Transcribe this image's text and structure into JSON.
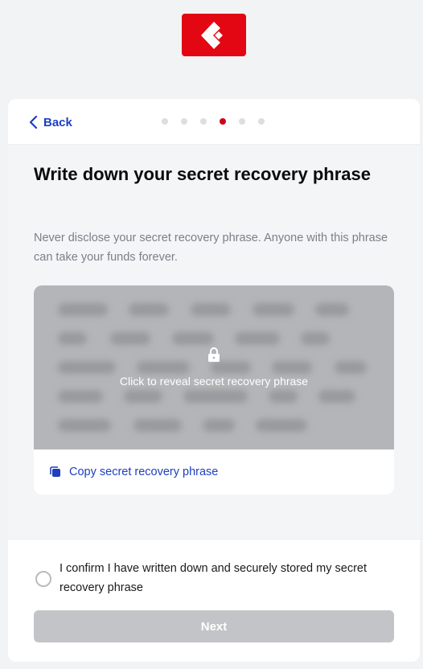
{
  "header": {
    "logo_icon": "brand-logo-icon",
    "brand_color": "#e30613"
  },
  "nav": {
    "back_label": "Back",
    "steps_total": 6,
    "current_step": 4
  },
  "page": {
    "title": "Write down your secret recovery phrase",
    "subtitle": "Never disclose your secret recovery phrase. Anyone with this phrase can take your funds forever."
  },
  "phrase": {
    "reveal_text": "Click to reveal secret recovery phrase",
    "copy_label": "Copy secret recovery phrase",
    "lock_icon": "lock-icon",
    "copy_icon": "copy-icon"
  },
  "confirm": {
    "checked": false,
    "label": "I confirm I have written down and securely stored my secret recovery phrase"
  },
  "actions": {
    "next_label": "Next",
    "next_enabled": false
  },
  "colors": {
    "accent": "#1d3fbf",
    "active_step": "#d0021b",
    "disabled_button": "#c3c4c7"
  }
}
